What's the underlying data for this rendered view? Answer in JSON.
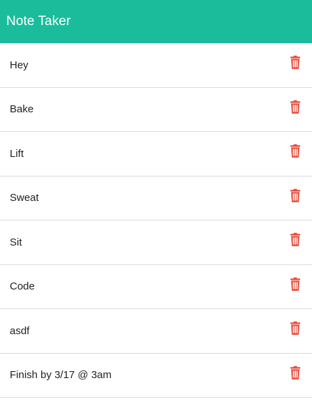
{
  "navbar": {
    "brand": "Note Taker"
  },
  "notes": [
    {
      "title": "Hey",
      "icon": "trash-icon"
    },
    {
      "title": "Bake",
      "icon": "trash-icon"
    },
    {
      "title": "Lift",
      "icon": "trash-icon"
    },
    {
      "title": "Sweat",
      "icon": "trash-icon"
    },
    {
      "title": "Sit",
      "icon": "trash-icon"
    },
    {
      "title": "Code",
      "icon": "trash-icon"
    },
    {
      "title": "asdf",
      "icon": "trash-icon"
    },
    {
      "title": "Finish by 3/17 @ 3am",
      "icon": "trash-icon"
    }
  ],
  "colors": {
    "navbar_bg": "#1abc9c",
    "delete_icon": "#e74c3c",
    "divider": "#dcdcdc"
  }
}
